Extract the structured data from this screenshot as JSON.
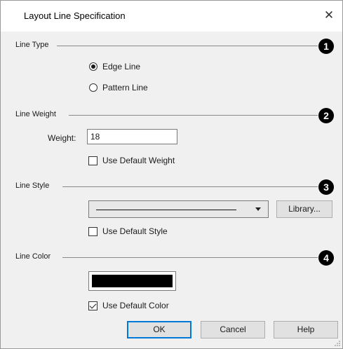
{
  "window": {
    "title": "Layout Line Specification",
    "close_glyph": "✕"
  },
  "sections": {
    "line_type": {
      "label": "Line Type",
      "callout": "1",
      "options": [
        {
          "label": "Edge Line",
          "selected": true
        },
        {
          "label": "Pattern Line",
          "selected": false
        }
      ]
    },
    "line_weight": {
      "label": "Line Weight",
      "callout": "2",
      "weight_label": "Weight:",
      "weight_value": "18",
      "default_checkbox": {
        "label": "Use Default Weight",
        "checked": false
      }
    },
    "line_style": {
      "label": "Line Style",
      "callout": "3",
      "library_button": "Library...",
      "default_checkbox": {
        "label": "Use Default Style",
        "checked": false
      }
    },
    "line_color": {
      "label": "Line Color",
      "callout": "4",
      "swatch_color": "#000000",
      "default_checkbox": {
        "label": "Use Default Color",
        "checked": true
      }
    }
  },
  "buttons": {
    "ok": "OK",
    "cancel": "Cancel",
    "help": "Help"
  }
}
